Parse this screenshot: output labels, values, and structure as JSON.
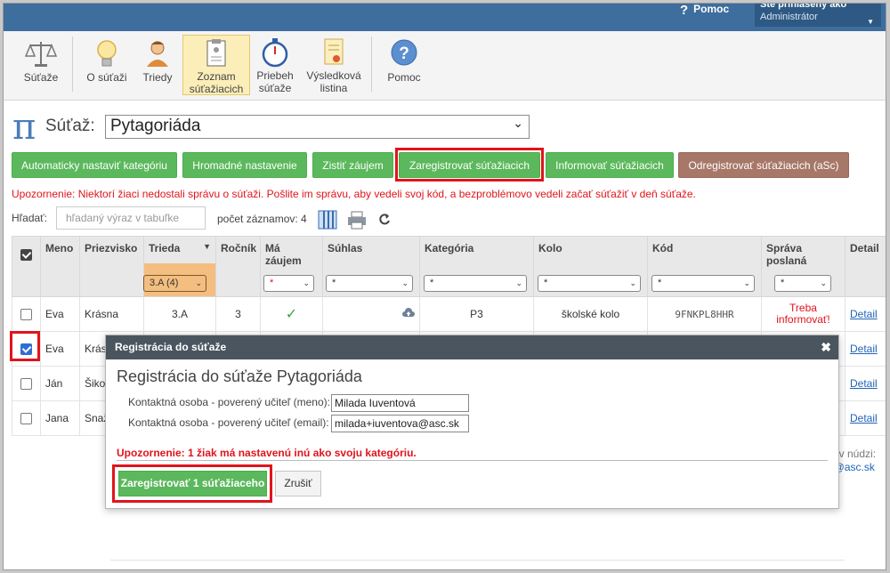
{
  "header": {
    "help_label": "Pomoc",
    "user_line1": "Ste prihlásený ako",
    "user_line2": "Administrátor"
  },
  "toolbar": {
    "items": [
      {
        "label_l1": "Súťaže",
        "label_l2": ""
      },
      {
        "label_l1": "O súťaži",
        "label_l2": ""
      },
      {
        "label_l1": "Triedy",
        "label_l2": ""
      },
      {
        "label_l1": "Zoznam",
        "label_l2": "súťažiacich"
      },
      {
        "label_l1": "Priebeh",
        "label_l2": "súťaže"
      },
      {
        "label_l1": "Výsledková",
        "label_l2": "listina"
      },
      {
        "label_l1": "Pomoc",
        "label_l2": ""
      }
    ]
  },
  "competition": {
    "label": "Súťaž:",
    "selected": "Pytagoriáda"
  },
  "actions": {
    "auto_category": "Automaticky nastaviť kategóriu",
    "bulk_settings": "Hromadné nastavenie",
    "check_interest": "Zistiť záujem",
    "register": "Zaregistrovať súťažiacich",
    "inform": "Informovať súťažiacich",
    "unregister": "Odregistrovať súťažiacich (aSc)"
  },
  "warning": "Upozornenie: Niektorí žiaci nedostali správu o súťaži. Pošlite im správu, aby vedeli svoj kód, a bezproblémovo vedeli začať súťažiť v deň súťaže.",
  "search": {
    "label": "Hľadať:",
    "placeholder": "hľadaný výraz v tabuľke",
    "count_text": "počet záznamov: 4"
  },
  "table": {
    "headers": {
      "meno": "Meno",
      "priezvisko": "Priezvisko",
      "trieda": "Trieda",
      "rocnik": "Ročník",
      "ma_zaujem_l1": "Má",
      "ma_zaujem_l2": "záujem",
      "suhlas": "Súhlas",
      "kategoria": "Kategória",
      "kolo": "Kolo",
      "kod": "Kód",
      "sprava_l1": "Správa",
      "sprava_l2": "poslaná",
      "detail": "Detail"
    },
    "filters": {
      "trieda": "3.A (4)",
      "any": "*"
    },
    "rows": [
      {
        "meno": "Eva",
        "priezvisko": "Krásna",
        "trieda": "3.A",
        "rocnik": "3",
        "kategoria": "P3",
        "kolo": "školské kolo",
        "kod": "9FNKPL8HHR",
        "sprava_l1": "Treba",
        "sprava_l2": "informovať!",
        "detail": "Detail",
        "checked": false
      },
      {
        "meno": "Eva",
        "priezvisko": "Krás",
        "detail": "Detail",
        "checked": true
      },
      {
        "meno": "Ján",
        "priezvisko": "Šikov",
        "detail": "Detail",
        "checked": false
      },
      {
        "meno": "Jana",
        "priezvisko": "Snaž",
        "detail": "Detail",
        "checked": false
      }
    ]
  },
  "side": {
    "line1": "kt v núdzi:",
    "line2": "e@asc.sk"
  },
  "modal": {
    "header": "Registrácia do súťaže",
    "title": "Registrácia do súťaže Pytagoriáda",
    "name_label": "Kontaktná osoba - poverený učiteľ (meno):",
    "name_value": "Milada Iuventová",
    "email_label": "Kontaktná osoba - poverený učiteľ (email):",
    "email_value": "milada+iuventova@asc.sk",
    "warning": "Upozornenie: 1 žiak má nastavenú inú ako svoju kategóriu.",
    "ok_button": "Zaregistrovať 1 súťažiaceho",
    "cancel_button": "Zrušiť"
  },
  "colors": {
    "topbar": "#3d6e9e",
    "green": "#5cb85c",
    "brown": "#a77768",
    "warning_red": "#e0141c",
    "highlight_red": "#e0141c",
    "active_tab": "#fbeeb8"
  }
}
